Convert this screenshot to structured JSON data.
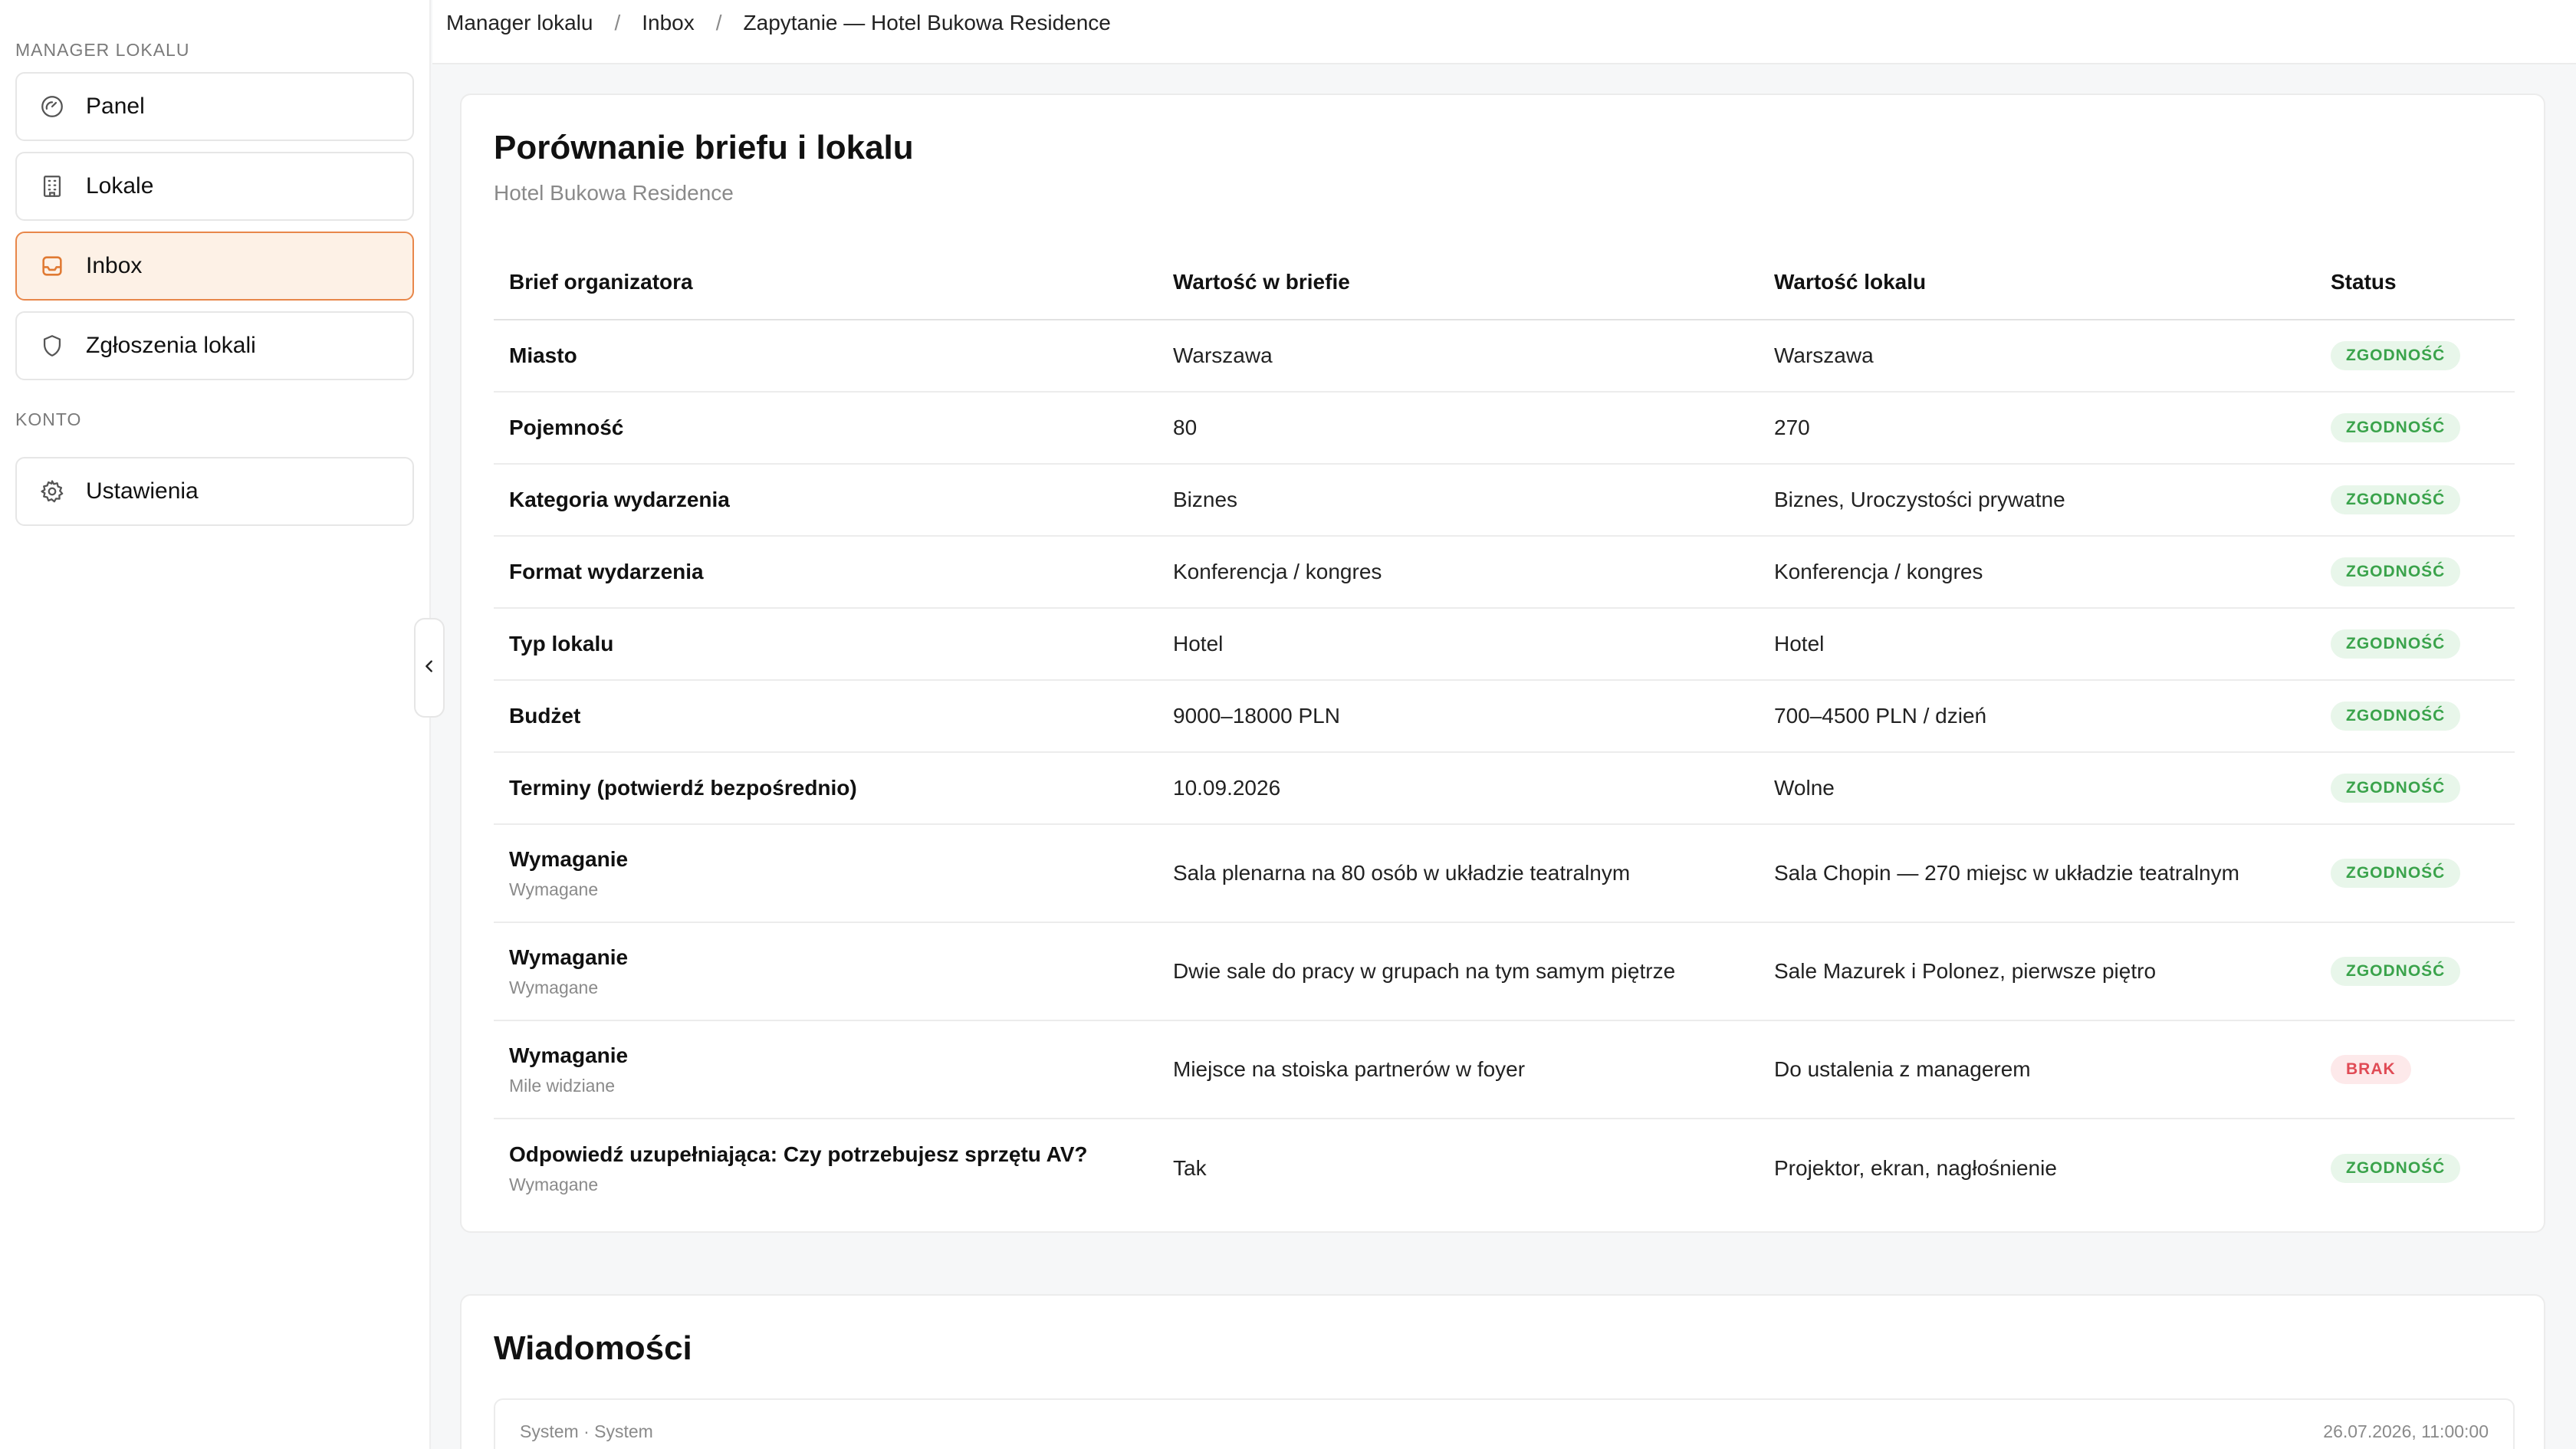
{
  "sidebar": {
    "section_manager": "MANAGER LOKALU",
    "section_account": "KONTO",
    "items": [
      {
        "label": "Panel",
        "icon": "gauge-icon"
      },
      {
        "label": "Lokale",
        "icon": "building-icon"
      },
      {
        "label": "Inbox",
        "icon": "inbox-icon",
        "active": true
      },
      {
        "label": "Zgłoszenia lokali",
        "icon": "shield-icon"
      }
    ],
    "settings": {
      "label": "Ustawienia",
      "icon": "gear-icon"
    }
  },
  "breadcrumb": [
    "Manager lokalu",
    "Inbox",
    "Zapytanie — Hotel Bukowa Residence"
  ],
  "comparison": {
    "title": "Porównanie briefu i lokalu",
    "subtitle": "Hotel Bukowa Residence",
    "columns": [
      "Brief organizatora",
      "Wartość w briefie",
      "Wartość lokalu",
      "Status"
    ],
    "rows": [
      {
        "label": "Miasto",
        "sub": "",
        "brief": "Warszawa",
        "venue": "Warszawa",
        "status": "ZGODNOŚĆ"
      },
      {
        "label": "Pojemność",
        "sub": "",
        "brief": "80",
        "venue": "270",
        "status": "ZGODNOŚĆ"
      },
      {
        "label": "Kategoria wydarzenia",
        "sub": "",
        "brief": "Biznes",
        "venue": "Biznes, Uroczystości prywatne",
        "status": "ZGODNOŚĆ"
      },
      {
        "label": "Format wydarzenia",
        "sub": "",
        "brief": "Konferencja / kongres",
        "venue": "Konferencja / kongres",
        "status": "ZGODNOŚĆ"
      },
      {
        "label": "Typ lokalu",
        "sub": "",
        "brief": "Hotel",
        "venue": "Hotel",
        "status": "ZGODNOŚĆ"
      },
      {
        "label": "Budżet",
        "sub": "",
        "brief": "9000–18000 PLN",
        "venue": "700–4500 PLN / dzień",
        "status": "ZGODNOŚĆ"
      },
      {
        "label": "Terminy (potwierdź bezpośrednio)",
        "sub": "",
        "brief": "10.09.2026",
        "venue": "Wolne",
        "status": "ZGODNOŚĆ"
      },
      {
        "label": "Wymaganie",
        "sub": "Wymagane",
        "brief": "Sala plenarna na 80 osób w układzie teatralnym",
        "venue": "Sala Chopin — 270 miejsc w układzie teatralnym",
        "status": "ZGODNOŚĆ"
      },
      {
        "label": "Wymaganie",
        "sub": "Wymagane",
        "brief": "Dwie sale do pracy w grupach na tym samym piętrze",
        "venue": "Sale Mazurek i Polonez, pierwsze piętro",
        "status": "ZGODNOŚĆ"
      },
      {
        "label": "Wymaganie",
        "sub": "Mile widziane",
        "brief": "Miejsce na stoiska partnerów w foyer",
        "venue": "Do ustalenia z managerem",
        "status": "BRAK"
      },
      {
        "label": "Odpowiedź uzupełniająca: Czy potrzebujesz sprzętu AV?",
        "sub": "Wymagane",
        "brief": "Tak",
        "venue": "Projektor, ekran, nagłośnienie",
        "status": "ZGODNOŚĆ"
      }
    ]
  },
  "messages": {
    "title": "Wiadomości",
    "items": [
      {
        "sender": "System · System",
        "time": "26.07.2026, 11:00:00"
      }
    ]
  },
  "colors": {
    "accent": "#e07a33",
    "active_bg": "#fdf1e6",
    "ok_text": "#3aa34b",
    "ok_bg": "#e8f6ea",
    "no_text": "#e04b55",
    "no_bg": "#fde9ea"
  }
}
